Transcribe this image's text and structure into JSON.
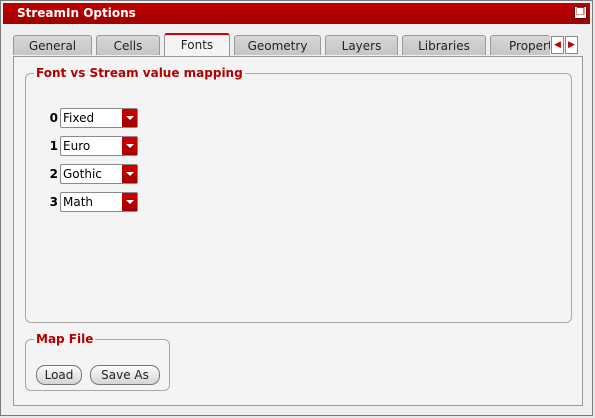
{
  "window": {
    "title": "StreamIn Options"
  },
  "tabs": [
    {
      "label": "General"
    },
    {
      "label": "Cells"
    },
    {
      "label": "Fonts",
      "active": true
    },
    {
      "label": "Geometry"
    },
    {
      "label": "Layers"
    },
    {
      "label": "Libraries"
    },
    {
      "label": "Propert"
    }
  ],
  "font_mapping": {
    "title": "Font vs Stream value mapping",
    "rows": [
      {
        "index": "0",
        "font": "Fixed"
      },
      {
        "index": "1",
        "font": "Euro"
      },
      {
        "index": "2",
        "font": "Gothic"
      },
      {
        "index": "3",
        "font": "Math"
      }
    ]
  },
  "map_file": {
    "title": "Map File",
    "load_label": "Load",
    "save_as_label": "Save As"
  },
  "colors": {
    "accent": "#c00000",
    "group_title": "#b00000"
  }
}
